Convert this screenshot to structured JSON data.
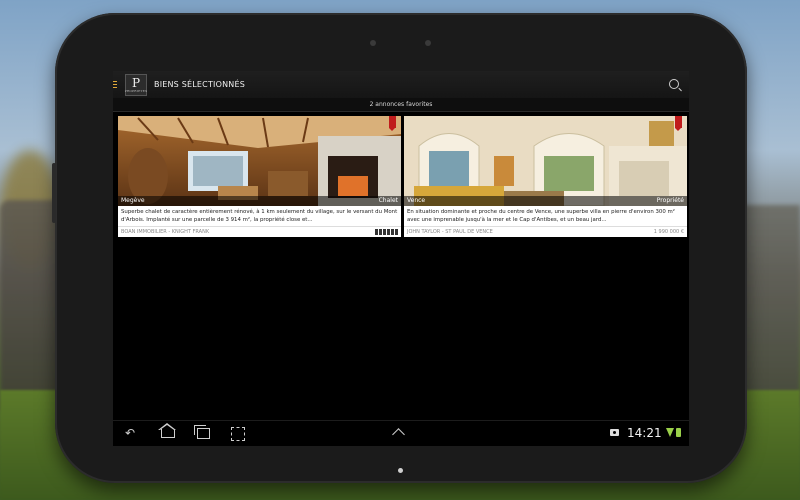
{
  "header": {
    "logo_letter": "P",
    "logo_sub": "PROPRIETES",
    "title": "BIENS SÉLECTIONNÉS"
  },
  "subheader": {
    "text": "2 annonces favorites"
  },
  "listings": [
    {
      "location": "Megève",
      "type": "Chalet",
      "description": "Superbe chalet de caractère entièrement rénové, à 1 km seulement du village, sur le versant du Mont d'Arbois. Implanté sur une parcelle de 3 914 m², la propriété close et...",
      "agency": "BOAN IMMOBILIER - KNIGHT FRANK",
      "price": ""
    },
    {
      "location": "Vence",
      "type": "Propriété",
      "description": "En situation dominante et proche du centre de Vence, une superbe villa en pierre d'environ 300 m² avec une imprenable jusqu'à la mer et le Cap d'Antibes, et un beau jard...",
      "agency": "JOHN TAYLOR - ST PAUL DE VENCE",
      "price": "1 990 000 €"
    }
  ],
  "statusbar": {
    "time": "14:21"
  },
  "colors": {
    "favorite_ribbon": "#c01c1c",
    "battery": "#9ad04a",
    "menu_accent": "#e0a83a"
  }
}
